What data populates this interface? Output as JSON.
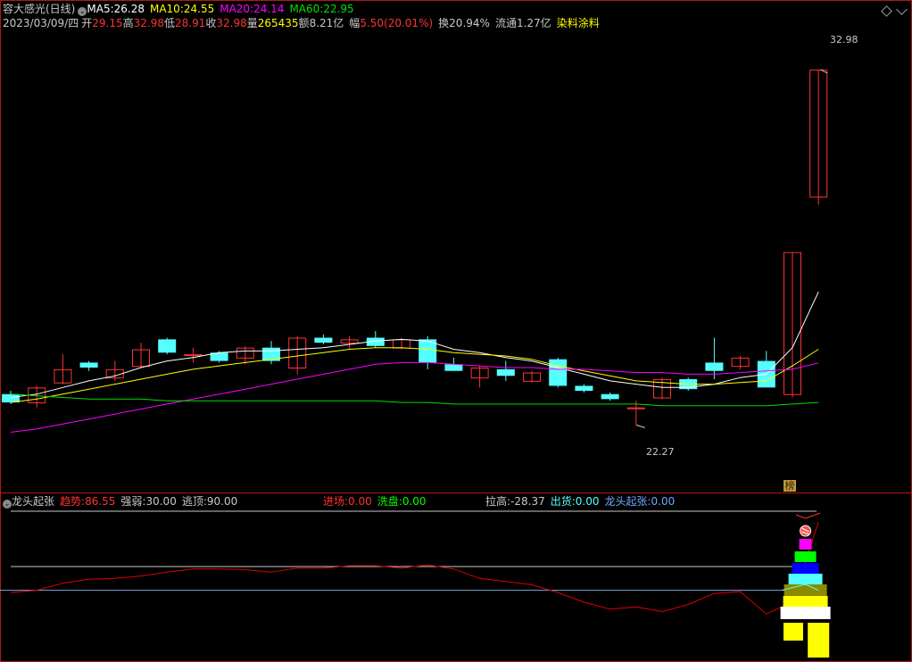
{
  "title": "容大感光(日线)",
  "ma": [
    {
      "label": "MA5:",
      "value": "26.28",
      "color": "#ffffff"
    },
    {
      "label": "MA10:",
      "value": "24.55",
      "color": "#ffff00"
    },
    {
      "label": "MA20:",
      "value": "24.14",
      "color": "#ff00ff"
    },
    {
      "label": "MA60:",
      "value": "22.95",
      "color": "#00e000"
    }
  ],
  "info": {
    "date": "2023/03/09/四",
    "open_label": "开",
    "open": "29.15",
    "high_label": "高",
    "high": "32.98",
    "low_label": "低",
    "low": "28.91",
    "close_label": "收",
    "close": "32.98",
    "vol_label": "量",
    "vol": "265435",
    "amount_label": "额",
    "amount": "8.21亿",
    "change_label": "幅",
    "change": "5.50(20.01%)",
    "turnover_label": "换",
    "turnover": "20.94%",
    "float_label": "流通",
    "float": "1.27亿",
    "industry": "染料涂料"
  },
  "annotations": {
    "high_marker": "32.98",
    "low_marker": "22.27",
    "badge": "榜"
  },
  "indicator": {
    "name": "龙头起张",
    "trend_label": "趋势:",
    "trend": "86.55",
    "strength_label": "强弱:",
    "strength": "30.00",
    "escape_label": "逃顶:",
    "escape": "90.00",
    "entry_label": "进场:",
    "entry": "0.00",
    "wash_label": "洗盘:",
    "wash": "0.00",
    "pull_label": "拉高:",
    "pull": "-28.37",
    "ship_label": "出货:",
    "ship": "0.00",
    "dragon_label": "龙头起张:",
    "dragon": "0.00"
  },
  "colors": {
    "up": "#ff3232",
    "down": "#54ffff",
    "bg": "#000000",
    "frame": "#b01818",
    "trend_line": "#e00000"
  },
  "chart_data": [
    {
      "type": "candlestick",
      "ylim": [
        21.5,
        34.0
      ],
      "grid": false,
      "candles": [
        {
          "o": 23.2,
          "c": 22.95,
          "h": 23.3,
          "l": 22.9
        },
        {
          "o": 22.95,
          "c": 23.4,
          "h": 23.45,
          "l": 22.8
        },
        {
          "o": 23.55,
          "c": 23.95,
          "h": 24.4,
          "l": 23.5
        },
        {
          "o": 24.15,
          "c": 24.0,
          "h": 24.2,
          "l": 23.9
        },
        {
          "o": 23.7,
          "c": 23.95,
          "h": 24.2,
          "l": 23.6
        },
        {
          "o": 24.05,
          "c": 24.55,
          "h": 24.75,
          "l": 24.0
        },
        {
          "o": 24.85,
          "c": 24.45,
          "h": 24.9,
          "l": 24.4
        },
        {
          "o": 24.4,
          "c": 24.4,
          "h": 24.6,
          "l": 24.15
        },
        {
          "o": 24.45,
          "c": 24.2,
          "h": 24.5,
          "l": 24.15
        },
        {
          "o": 24.3,
          "c": 24.6,
          "h": 24.65,
          "l": 24.1
        },
        {
          "o": 24.6,
          "c": 24.2,
          "h": 24.8,
          "l": 24.1
        },
        {
          "o": 24.0,
          "c": 24.9,
          "h": 24.95,
          "l": 23.8
        },
        {
          "o": 24.9,
          "c": 24.75,
          "h": 25.0,
          "l": 24.7
        },
        {
          "o": 24.75,
          "c": 24.85,
          "h": 24.95,
          "l": 24.55
        },
        {
          "o": 24.9,
          "c": 24.65,
          "h": 25.1,
          "l": 24.6
        },
        {
          "o": 24.6,
          "c": 24.85,
          "h": 24.9,
          "l": 24.55
        },
        {
          "o": 24.85,
          "c": 24.15,
          "h": 24.95,
          "l": 23.95
        },
        {
          "o": 24.1,
          "c": 23.9,
          "h": 24.3,
          "l": 23.9
        },
        {
          "o": 23.7,
          "c": 24.0,
          "h": 24.05,
          "l": 23.4
        },
        {
          "o": 23.95,
          "c": 23.75,
          "h": 24.2,
          "l": 23.6
        },
        {
          "o": 23.6,
          "c": 23.85,
          "h": 23.9,
          "l": 23.55
        },
        {
          "o": 24.25,
          "c": 23.45,
          "h": 24.3,
          "l": 23.4
        },
        {
          "o": 23.45,
          "c": 23.3,
          "h": 23.5,
          "l": 23.25
        },
        {
          "o": 23.2,
          "c": 23.05,
          "h": 23.25,
          "l": 23.0
        },
        {
          "o": 22.8,
          "c": 22.8,
          "h": 23.0,
          "l": 22.27
        },
        {
          "o": 23.1,
          "c": 23.65,
          "h": 23.7,
          "l": 23.05
        },
        {
          "o": 23.65,
          "c": 23.35,
          "h": 23.7,
          "l": 23.3
        },
        {
          "o": 24.15,
          "c": 23.9,
          "h": 24.9,
          "l": 23.65
        },
        {
          "o": 24.05,
          "c": 24.3,
          "h": 24.35,
          "l": 23.95
        },
        {
          "o": 24.2,
          "c": 23.4,
          "h": 24.5,
          "l": 23.4
        },
        {
          "o": 23.2,
          "c": 27.48,
          "h": 27.48,
          "l": 23.1
        },
        {
          "o": 29.15,
          "c": 32.98,
          "h": 32.98,
          "l": 28.91
        }
      ],
      "ma": {
        "MA5": [
          23.1,
          23.2,
          23.4,
          23.6,
          23.75,
          24.0,
          24.2,
          24.3,
          24.45,
          24.5,
          24.5,
          24.55,
          24.6,
          24.7,
          24.8,
          24.85,
          24.8,
          24.55,
          24.45,
          24.3,
          24.2,
          24.0,
          23.8,
          23.6,
          23.5,
          23.4,
          23.4,
          23.5,
          23.7,
          23.8,
          24.6,
          26.28
        ],
        "MA10": [
          22.95,
          23.05,
          23.2,
          23.35,
          23.5,
          23.65,
          23.8,
          23.95,
          24.05,
          24.15,
          24.25,
          24.35,
          24.45,
          24.55,
          24.6,
          24.6,
          24.55,
          24.45,
          24.4,
          24.35,
          24.25,
          24.05,
          23.9,
          23.75,
          23.6,
          23.55,
          23.5,
          23.5,
          23.55,
          23.6,
          24.05,
          24.55
        ],
        "MA20": [
          22.05,
          22.15,
          22.3,
          22.45,
          22.6,
          22.75,
          22.9,
          23.05,
          23.2,
          23.35,
          23.5,
          23.65,
          23.8,
          23.95,
          24.1,
          24.15,
          24.15,
          24.1,
          24.05,
          24.0,
          24.0,
          23.95,
          23.95,
          23.9,
          23.85,
          23.85,
          23.8,
          23.8,
          23.85,
          23.9,
          23.95,
          24.14
        ],
        "MA60": [
          23.2,
          23.15,
          23.1,
          23.05,
          23.05,
          23.05,
          23.0,
          23.0,
          23.0,
          23.0,
          23.0,
          23.0,
          23.0,
          23.0,
          23.0,
          22.95,
          22.95,
          22.9,
          22.9,
          22.9,
          22.9,
          22.9,
          22.9,
          22.9,
          22.9,
          22.85,
          22.85,
          22.85,
          22.85,
          22.85,
          22.9,
          22.95
        ]
      }
    },
    {
      "type": "line",
      "title": "龙头起张",
      "ylim": [
        -40,
        100
      ],
      "reference_lines": [
        100,
        30,
        0
      ],
      "trend": [
        -3,
        0,
        9,
        14,
        15,
        18,
        23,
        27,
        27,
        26,
        23,
        28,
        28,
        31,
        31,
        28,
        32,
        27,
        15,
        11,
        7,
        -3,
        -15,
        -24,
        -21,
        -27,
        -18,
        -4,
        -2,
        -30,
        -15,
        86.55
      ]
    }
  ]
}
